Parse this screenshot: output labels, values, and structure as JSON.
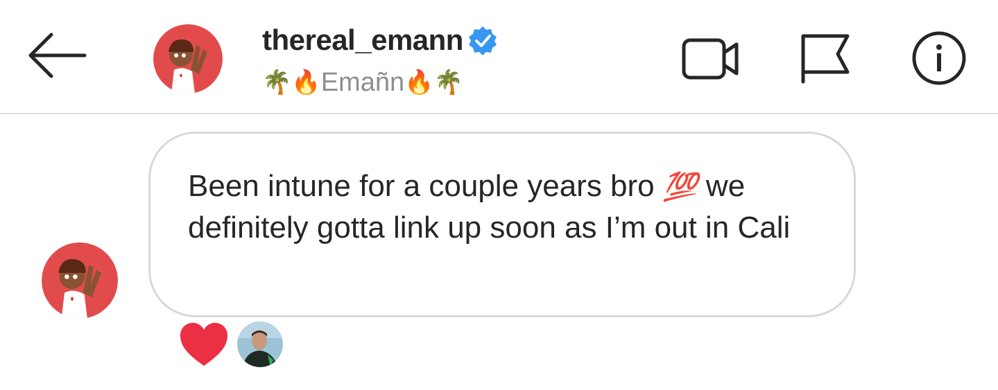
{
  "header": {
    "back_icon": "arrow-left-icon",
    "username": "thereal_emann",
    "verified_icon": "verified-badge-icon",
    "display_name": "Emañn",
    "display_name_prefix_emojis": [
      "🌴",
      "🔥"
    ],
    "display_name_suffix_emojis": [
      "🔥",
      "🌴"
    ],
    "actions": [
      {
        "icon": "video-camera-icon"
      },
      {
        "icon": "flag-icon"
      },
      {
        "icon": "info-icon"
      }
    ]
  },
  "message": {
    "text_before_emoji": "Been intune for a couple years bro ",
    "emoji": "💯",
    "text_after_emoji": " we definitely gotta link up soon as I’m out in Cali"
  },
  "reactions": {
    "reaction_icon": "heart-icon",
    "reaction_color": "#ed2f44"
  },
  "colors": {
    "verified_blue": "#3897f0",
    "avatar_bg": "#e24b4b",
    "text_primary": "#262626",
    "text_secondary": "#8e8e8e"
  }
}
